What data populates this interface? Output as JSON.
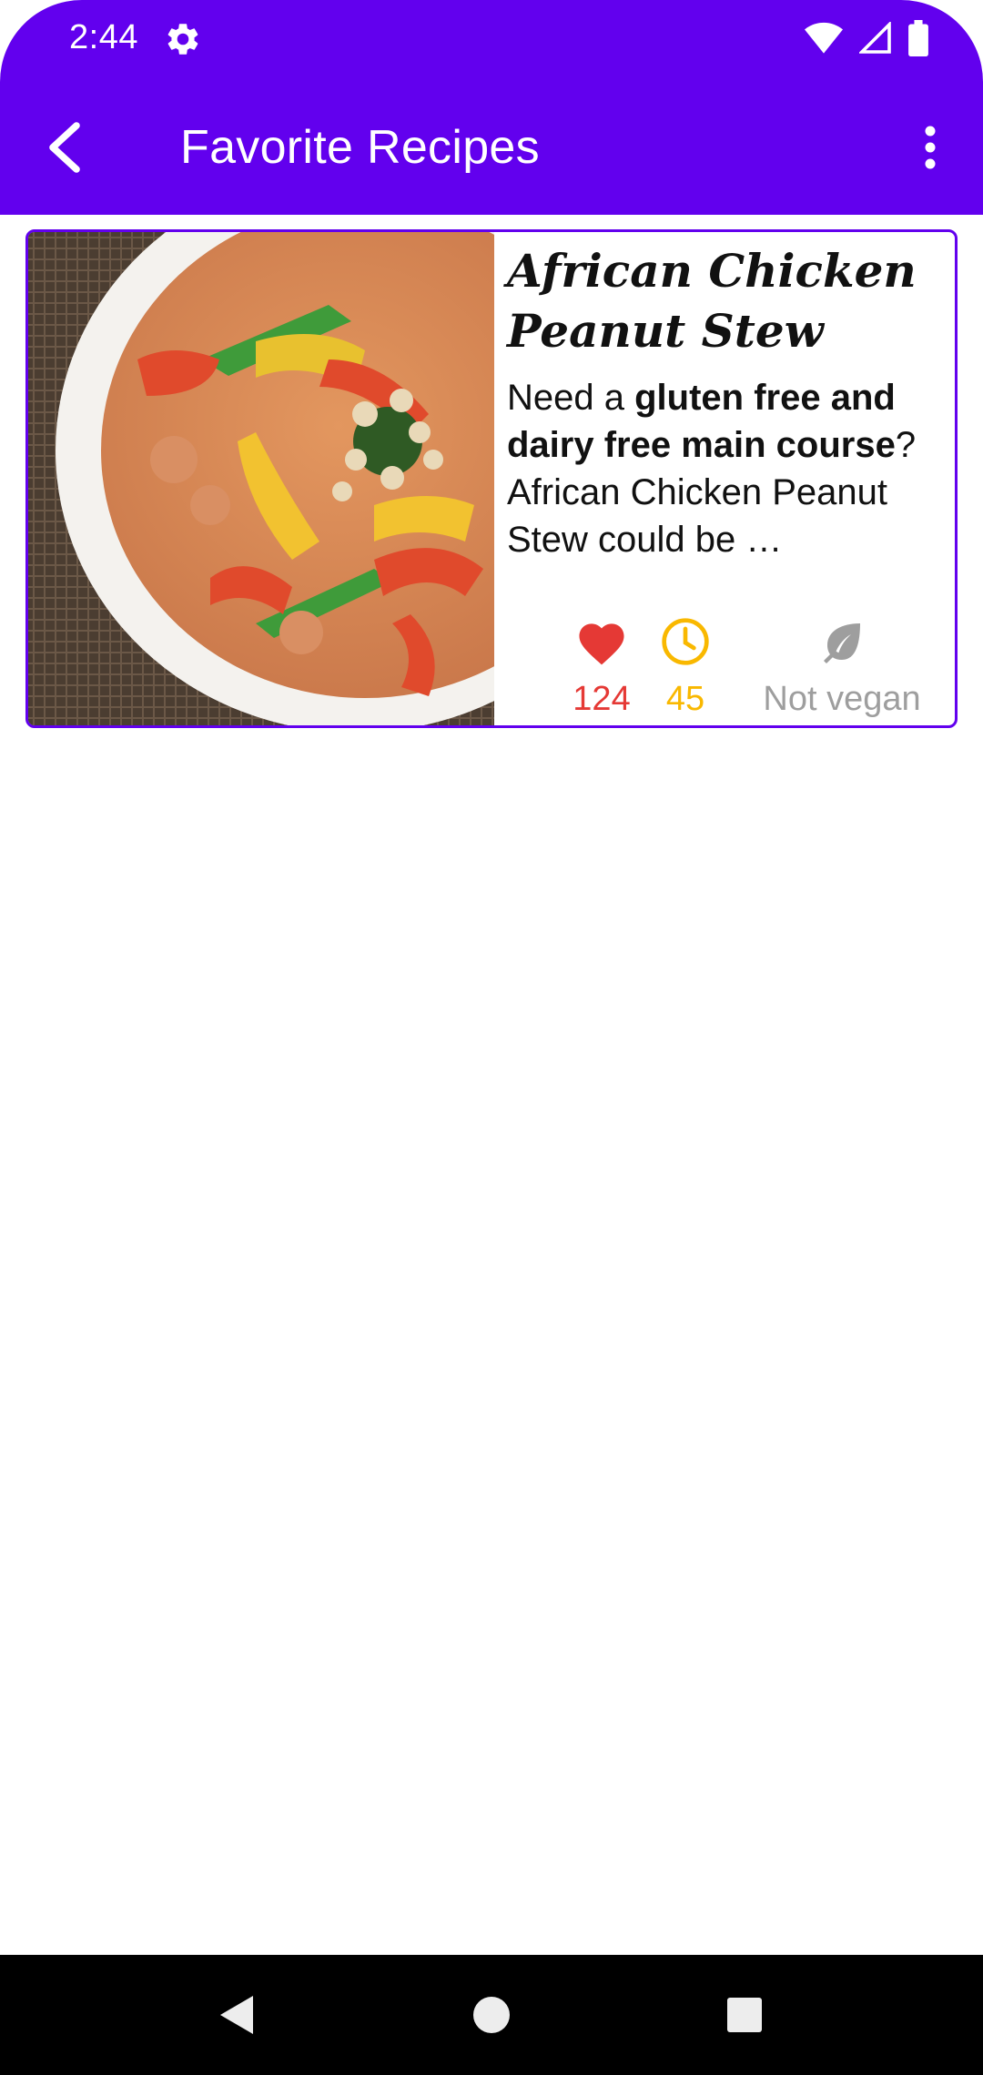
{
  "status_bar": {
    "time": "2:44",
    "icons": [
      "settings-gear-icon",
      "wifi-icon",
      "cell-signal-icon",
      "battery-icon"
    ]
  },
  "app_bar": {
    "title": "Favorite Recipes",
    "back_icon": "chevron-left-icon",
    "menu_icon": "more-vert-icon",
    "color": "#6200EE"
  },
  "recipes": [
    {
      "title": "African Chicken Peanut Stew",
      "description_parts": [
        {
          "text": "Need a ",
          "bold": false
        },
        {
          "text": "gluten free and dairy free main course",
          "bold": true
        },
        {
          "text": "? African Chicken Peanut Stew could be …",
          "bold": false
        }
      ],
      "likes": "124",
      "minutes": "45",
      "vegan_label": "Not vegan",
      "image": "african-chicken-peanut-stew-photo",
      "colors": {
        "likes": "#E53935",
        "time": "#F9B800",
        "vegan": "#9E9E9E",
        "border": "#6200EE"
      }
    }
  ],
  "nav_bar": {
    "buttons": [
      "nav-back-icon",
      "nav-home-icon",
      "nav-recents-icon"
    ]
  }
}
